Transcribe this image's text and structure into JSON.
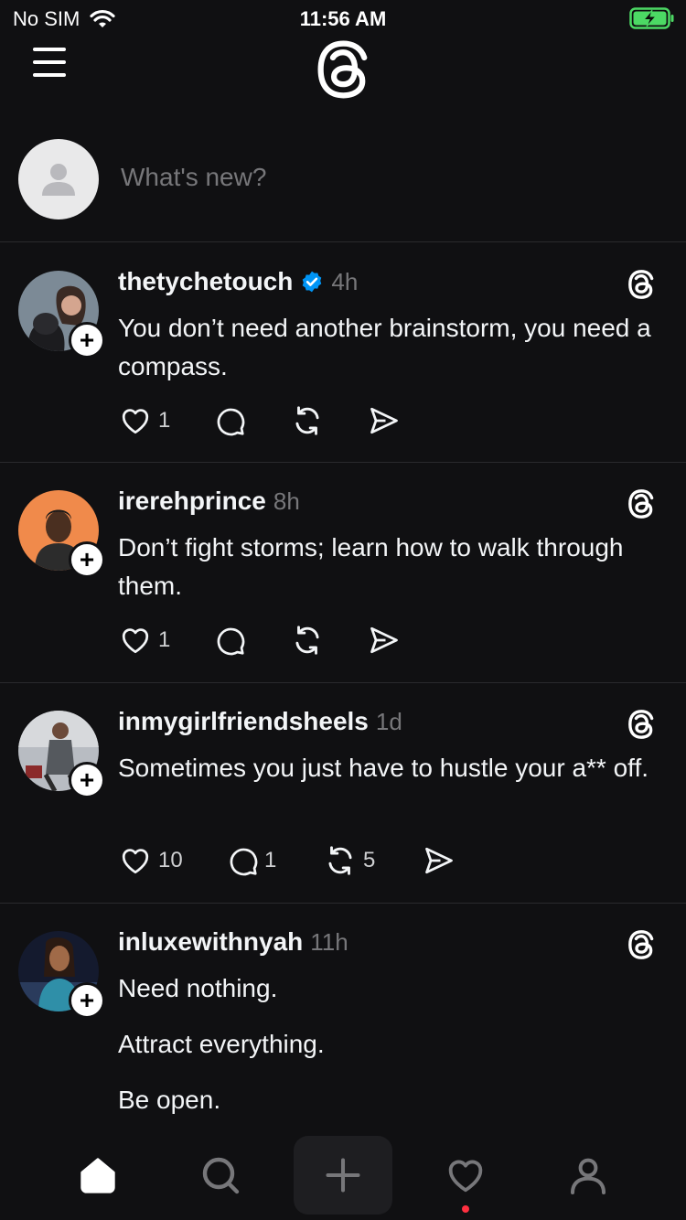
{
  "status_bar": {
    "carrier": "No SIM",
    "time": "11:56 AM"
  },
  "composer": {
    "placeholder": "What's new?"
  },
  "colors": {
    "background": "#101012",
    "verified": "#0095f6",
    "notification_dot": "#ff3040"
  },
  "posts": [
    {
      "username": "thetychetouch",
      "verified": true,
      "time": "4h",
      "lines": [
        "You don’t need another brainstorm, you need a compass."
      ],
      "likes": "1",
      "replies": "",
      "reposts": ""
    },
    {
      "username": "irerehprince",
      "verified": false,
      "time": "8h",
      "lines": [
        "Don’t fight storms; learn how to walk through them."
      ],
      "likes": "1",
      "replies": "",
      "reposts": ""
    },
    {
      "username": "inmygirlfriendsheels",
      "verified": false,
      "time": "1d",
      "lines": [
        "Sometimes you just have to hustle your a** off."
      ],
      "likes": "10",
      "replies": "1",
      "reposts": "5"
    },
    {
      "username": "inluxewithnyah",
      "verified": false,
      "time": "11h",
      "lines": [
        "Need nothing.",
        "Attract everything.",
        "Be open."
      ],
      "likes": "",
      "replies": "",
      "reposts": ""
    }
  ],
  "tab_bar": {
    "items": [
      "home-icon",
      "search-icon",
      "new-thread-icon",
      "activity-heart-icon",
      "profile-icon"
    ],
    "activity_has_notification": true
  }
}
